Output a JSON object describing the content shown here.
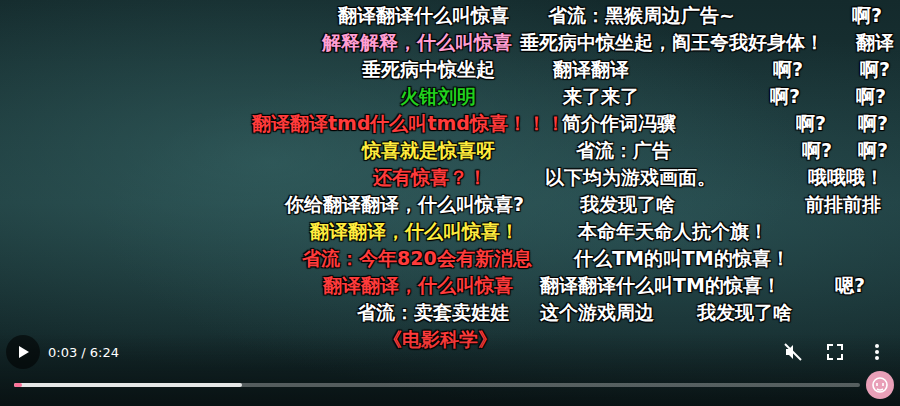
{
  "player": {
    "danmaku": [
      {
        "text": "翻译翻译什么叫惊喜",
        "color": "#ffffff"
      },
      {
        "text": "省流：黑猴周边广告~",
        "color": "#ffffff"
      },
      {
        "text": "啊?",
        "color": "#ffffff"
      },
      {
        "text": "解释解释，什么叫惊喜",
        "color": "#ff9ed2"
      },
      {
        "text": "垂死病中惊坐起，阎王夸我好身体！",
        "color": "#ffffff"
      },
      {
        "text": "翻译",
        "color": "#ffffff"
      },
      {
        "text": "垂死病中惊坐起",
        "color": "#ffffff"
      },
      {
        "text": "翻译翻译",
        "color": "#ffffff"
      },
      {
        "text": "啊?",
        "color": "#ffffff"
      },
      {
        "text": "啊?",
        "color": "#ffffff"
      },
      {
        "text": "火钳刘明",
        "color": "#22d11e"
      },
      {
        "text": "来了来了",
        "color": "#ffffff"
      },
      {
        "text": "啊?",
        "color": "#ffffff"
      },
      {
        "text": "啊?",
        "color": "#ffffff"
      },
      {
        "text": "翻译翻译tmd什么叫tmd惊喜！！！",
        "color": "#ff3b3b"
      },
      {
        "text": "简介作词冯骥",
        "color": "#ffffff"
      },
      {
        "text": "啊?",
        "color": "#ffffff"
      },
      {
        "text": "啊?",
        "color": "#ffffff"
      },
      {
        "text": "惊喜就是惊喜呀",
        "color": "#ffec3d"
      },
      {
        "text": "省流：广告",
        "color": "#ffffff"
      },
      {
        "text": "啊?",
        "color": "#ffffff"
      },
      {
        "text": "啊?",
        "color": "#ffffff"
      },
      {
        "text": "还有惊喜？！",
        "color": "#ff3b3b"
      },
      {
        "text": "以下均为游戏画面。",
        "color": "#ffffff"
      },
      {
        "text": "哦哦哦！",
        "color": "#ffffff"
      },
      {
        "text": "你给翻译翻译，什么叫惊喜?",
        "color": "#ffffff"
      },
      {
        "text": "我发现了啥",
        "color": "#ffffff"
      },
      {
        "text": "前排前排",
        "color": "#ffffff"
      },
      {
        "text": "翻译翻译，什么叫惊喜！",
        "color": "#ffec3d"
      },
      {
        "text": "本命年天命人抗个旗！",
        "color": "#ffffff"
      },
      {
        "text": "省流：今年820会有新消息",
        "color": "#ff3b3b"
      },
      {
        "text": "什么TM的叫TM的惊喜！",
        "color": "#ffffff"
      },
      {
        "text": "翻译翻译，什么叫惊喜",
        "color": "#ff3b3b"
      },
      {
        "text": "翻译翻译什么叫TM的惊喜！",
        "color": "#ffffff"
      },
      {
        "text": "嗯?",
        "color": "#ffffff"
      },
      {
        "text": "省流：卖套卖娃娃",
        "color": "#ffffff"
      },
      {
        "text": "这个游戏周边",
        "color": "#ffffff"
      },
      {
        "text": "我发现了啥",
        "color": "#ffffff"
      },
      {
        "text": "《电影科学》",
        "color": "#ff3b3b"
      }
    ],
    "playing": false,
    "muted": true,
    "time": "0:03 / 6:24",
    "progress": {
      "played": 0.01,
      "buffered": 0.27
    }
  }
}
